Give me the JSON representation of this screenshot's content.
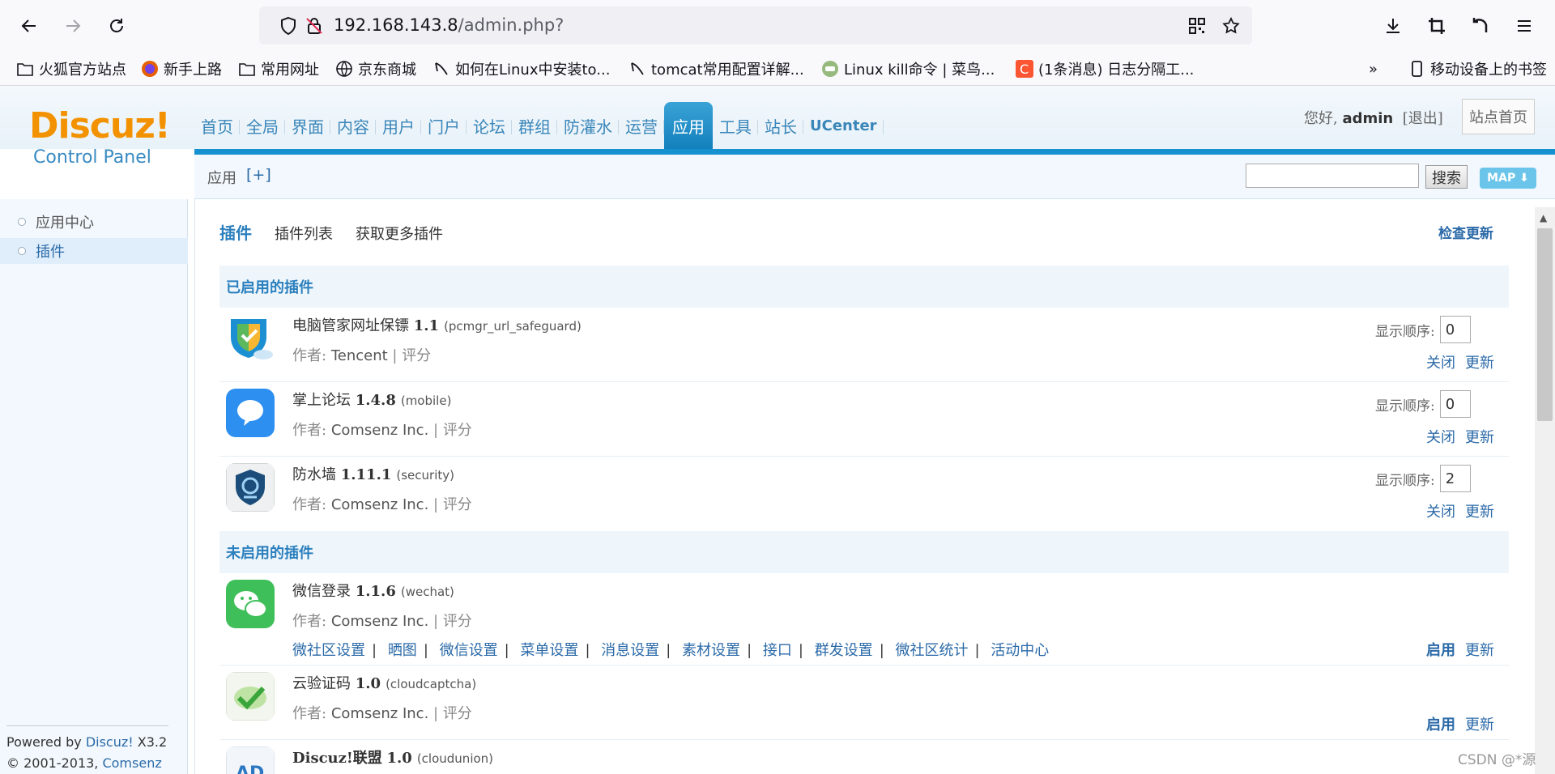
{
  "browser": {
    "url_host": "192.168.143.8",
    "url_path": "/admin.php?",
    "bookmarks": [
      {
        "label": "火狐官方站点",
        "icon": "folder-icon"
      },
      {
        "label": "新手上路",
        "icon": "firefox-icon"
      },
      {
        "label": "常用网址",
        "icon": "folder-icon"
      },
      {
        "label": "京东商城",
        "icon": "globe-icon"
      },
      {
        "label": "如何在Linux中安装to...",
        "icon": "pen-icon"
      },
      {
        "label": "tomcat常用配置详解...",
        "icon": "pen-icon"
      },
      {
        "label": "Linux kill命令 | 菜鸟...",
        "icon": "runoob-icon"
      },
      {
        "label": "(1条消息) 日志分隔工...",
        "icon": "csdn-icon"
      }
    ],
    "mobile_bookmarks": "移动设备上的书签"
  },
  "header": {
    "logo_main": "Discuz!",
    "logo_sub": "Control Panel",
    "nav": [
      "首页",
      "全局",
      "界面",
      "内容",
      "用户",
      "门户",
      "论坛",
      "群组",
      "防灌水",
      "运营",
      "应用",
      "工具",
      "站长",
      "UCenter"
    ],
    "active_nav": "应用",
    "greeting": "您好,",
    "username": "admin",
    "logout": "[退出]",
    "site_home": "站点首页"
  },
  "subbar": {
    "crumb": "应用",
    "add": "[+]",
    "search_button": "搜索",
    "map_button": "MAP ⬇"
  },
  "sidebar": {
    "items": [
      {
        "label": "应用中心",
        "active": false
      },
      {
        "label": "插件",
        "active": true
      }
    ],
    "powered_prefix": "Powered by ",
    "powered_brand": "Discuz!",
    "powered_version": " X3.2",
    "copyright_prefix": "© 2001-2013, ",
    "copyright_company": "Comsenz Inc."
  },
  "content": {
    "tabs": [
      "插件",
      "插件列表",
      "获取更多插件"
    ],
    "check_update": "检查更新",
    "enabled_heading": "已启用的插件",
    "disabled_heading": "未启用的插件",
    "order_label": "显示顺序:",
    "author_label": "作者:",
    "rate_label": "评分",
    "enabled": [
      {
        "name": "电脑管家网址保镖",
        "version": "1.1",
        "id": "(pcmgr_url_safeguard)",
        "author": "Tencent",
        "order": "0",
        "actions": [
          "关闭",
          "更新"
        ]
      },
      {
        "name": "掌上论坛",
        "version": "1.4.8",
        "id": "(mobile)",
        "author": "Comsenz Inc.",
        "order": "0",
        "actions": [
          "关闭",
          "更新"
        ]
      },
      {
        "name": "防水墙",
        "version": "1.11.1",
        "id": "(security)",
        "author": "Comsenz Inc.",
        "order": "2",
        "actions": [
          "关闭",
          "更新"
        ]
      }
    ],
    "disabled": [
      {
        "name": "微信登录",
        "version": "1.1.6",
        "id": "(wechat)",
        "author": "Comsenz Inc.",
        "actions": [
          "启用",
          "更新"
        ],
        "links": [
          "微社区设置",
          "晒图",
          "微信设置",
          "菜单设置",
          "消息设置",
          "素材设置",
          "接口",
          "群发设置",
          "微社区统计",
          "活动中心"
        ]
      },
      {
        "name": "云验证码",
        "version": "1.0",
        "id": "(cloudcaptcha)",
        "author": "Comsenz Inc.",
        "actions": [
          "启用",
          "更新"
        ]
      },
      {
        "name": "Discuz!联盟",
        "version": "1.0",
        "id": "(cloudunion)"
      }
    ]
  },
  "watermark": "CSDN @*源"
}
